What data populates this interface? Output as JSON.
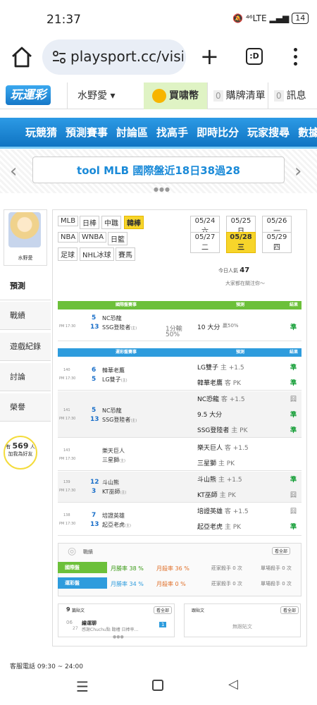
{
  "status": {
    "time": "21:37",
    "battery": "14",
    "signal": "⁴⁶LTE"
  },
  "browser": {
    "url": "playsport.cc/visit",
    "tabs_label": ":D"
  },
  "site": {
    "logo": "玩運彩",
    "user": "水野愛 ▾",
    "coin": "買啸幣",
    "cart_count": "0",
    "cart": "購牌清單",
    "msg_count": "0",
    "msg": "訊息"
  },
  "nav": [
    "玩競猜",
    "預測賽事",
    "討論區",
    "找高手",
    "即時比分",
    "玩家搜尋",
    "數據"
  ],
  "banner": {
    "text": "tool MLB 國際盤近18日38過28"
  },
  "side": {
    "name": "水野愛",
    "items": [
      "預測",
      "戰績",
      "遊戲紀錄",
      "討論",
      "榮譽"
    ],
    "bulb_pre": "有",
    "bulb_num": "569",
    "bulb_unit": "人",
    "bulb_post": "加我為好友"
  },
  "leagues": [
    "MLB",
    "日棒",
    "中職",
    "韓棒",
    "NBA",
    "WNBA",
    "日籃",
    "足球",
    "NHL冰球",
    "賽馬"
  ],
  "dates": [
    "05/24 六",
    "05/25 日",
    "05/26 一",
    "05/27 二",
    "05/28 三",
    "05/29 四"
  ],
  "popular": {
    "label": "今日人氣",
    "count": "47",
    "note": "大家都在關注你～"
  },
  "intl": {
    "header": "國際盤賽事",
    "pred": "預測",
    "result": "結果",
    "time": "PM 17:30",
    "g1": "5",
    "g2": "13",
    "t1": "NC恐龍",
    "t2": "SSG登陸者",
    "t2s": "(主)",
    "line": "1分輸",
    "pct": "50%",
    "pick": "10 大分",
    "pick2": "贏50%",
    "res": "準"
  },
  "local": {
    "header": "運彩盤賽事",
    "pred": "預測",
    "result": "結果",
    "games": [
      {
        "no": "140",
        "time": "PM 17:30",
        "s1": "6",
        "s2": "5",
        "t1": "韓華老鷹",
        "t2": "LG雙子",
        "t2s": "(主)",
        "picks": [
          {
            "p": "LG雙子",
            "x": "主 +1.5",
            "r": "準"
          },
          {
            "p": "韓華老鷹",
            "x": "客 PK",
            "r": "準"
          }
        ]
      },
      {
        "no": "141",
        "time": "PM 17:30",
        "s1": "5",
        "s2": "13",
        "t1": "NC恐龍",
        "t2": "SSG登陸者",
        "t2s": "(主)",
        "picks": [
          {
            "p": "NC恐龍",
            "x": "客 +1.5",
            "r": "囧"
          },
          {
            "p": "9.5 大分",
            "x": "",
            "r": "準"
          },
          {
            "p": "SSG登陸者",
            "x": "主 PK",
            "r": "準"
          }
        ]
      },
      {
        "no": "143",
        "time": "PM 17:30",
        "s1": "",
        "s2": "",
        "t1": "樂天巨人",
        "t2": "三星獅",
        "t2s": "(主)",
        "picks": [
          {
            "p": "樂天巨人",
            "x": "客 +1.5",
            "r": ""
          },
          {
            "p": "三星獅",
            "x": "主 PK",
            "r": ""
          }
        ]
      },
      {
        "no": "139",
        "time": "PM 17:30",
        "s1": "12",
        "s2": "3",
        "t1": "斗山熊",
        "t2": "KT巫師",
        "t2s": "(主)",
        "picks": [
          {
            "p": "斗山熊",
            "x": "主 +1.5",
            "r": "準"
          },
          {
            "p": "KT巫師",
            "x": "主 PK",
            "r": "囧"
          }
        ]
      },
      {
        "no": "138",
        "time": "PM 17:30",
        "s1": "7",
        "s2": "13",
        "t1": "培證英雄",
        "t2": "起亞老虎",
        "t2s": "(主)",
        "picks": [
          {
            "p": "培證英雄",
            "x": "客 +1.5",
            "r": "囧"
          },
          {
            "p": "起亞老虎",
            "x": "主 PK",
            "r": "準"
          }
        ]
      }
    ]
  },
  "record": {
    "title": "戰績",
    "more": "看全部",
    "rows": [
      {
        "label": "國際盤",
        "rate": "月勝率 38 %",
        "kill": "月殺率 36 %",
        "a": "莊家殺手 0 次",
        "b": "單場殺手 0 次"
      },
      {
        "label": "運彩盤",
        "rate": "月勝率 34 %",
        "kill": "月殺率 0 %",
        "a": "莊家殺手 0 次",
        "b": "單場殺手 0 次"
      }
    ]
  },
  "posts": {
    "count": "9",
    "title": "篇貼文",
    "more": "看全部",
    "date_m": "06",
    "date_d": "27",
    "post_title": "繪運聊",
    "post_sub": "感謝Chuchu點 聽槽 日棒率...",
    "reply": "1",
    "right_title": "跟貼文",
    "right_more": "看全部",
    "empty": "無跟貼文"
  },
  "footer": {
    "text": "客服電話 09:30 ~ 24:00"
  }
}
